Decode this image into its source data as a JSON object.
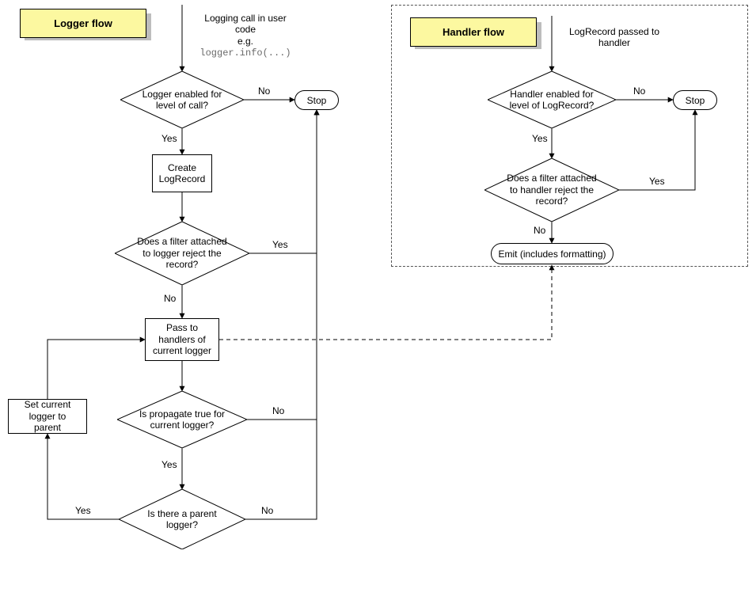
{
  "titles": {
    "logger": "Logger flow",
    "handler": "Handler flow"
  },
  "logger": {
    "entry_l1": "Logging call in user",
    "entry_l2": "code",
    "entry_l3": "e.g.",
    "entry_code": "logger.info(...)",
    "d_enabled_l1": "Logger enabled for",
    "d_enabled_l2": "level of call?",
    "no1": "No",
    "yes1": "Yes",
    "stop": "Stop",
    "create_l1": "Create",
    "create_l2": "LogRecord",
    "d_filter_l1": "Does a filter attached",
    "d_filter_l2": "to logger reject the",
    "d_filter_l3": "record?",
    "yes2": "Yes",
    "no2": "No",
    "pass_l1": "Pass to",
    "pass_l2": "handlers of",
    "pass_l3": "current logger",
    "d_prop_l1": "Is propagate true for",
    "d_prop_l2": "current logger?",
    "no3": "No",
    "yes3": "Yes",
    "d_parent_l1": "Is there a parent",
    "d_parent_l2": "logger?",
    "yes4": "Yes",
    "no4": "No",
    "set_parent_l1": "Set current",
    "set_parent_l2": "logger to parent"
  },
  "handler": {
    "entry_l1": "LogRecord passed to",
    "entry_l2": "handler",
    "d_enabled_l1": "Handler enabled for",
    "d_enabled_l2": "level of LogRecord?",
    "no1": "No",
    "yes1": "Yes",
    "stop": "Stop",
    "d_filter_l1": "Does a filter attached",
    "d_filter_l2": "to handler reject the",
    "d_filter_l3": "record?",
    "yes2": "Yes",
    "no2": "No",
    "emit": "Emit (includes formatting)"
  },
  "chart_data": {
    "type": "flowchart",
    "flows": [
      {
        "name": "Logger flow",
        "start": "Logging call in user code e.g. logger.info(...)",
        "nodes": [
          {
            "id": "L1",
            "type": "decision",
            "text": "Logger enabled for level of call?",
            "yes": "L2",
            "no": "LSTOP"
          },
          {
            "id": "L2",
            "type": "process",
            "text": "Create LogRecord",
            "next": "L3"
          },
          {
            "id": "L3",
            "type": "decision",
            "text": "Does a filter attached to logger reject the record?",
            "yes": "LSTOP",
            "no": "L4"
          },
          {
            "id": "L4",
            "type": "process",
            "text": "Pass to handlers of current logger",
            "next": "L5",
            "link_to_subflow": "Handler flow"
          },
          {
            "id": "L5",
            "type": "decision",
            "text": "Is propagate true for current logger?",
            "yes": "L6",
            "no": "LSTOP"
          },
          {
            "id": "L6",
            "type": "decision",
            "text": "Is there a parent logger?",
            "yes": "L7",
            "no": "LSTOP"
          },
          {
            "id": "L7",
            "type": "process",
            "text": "Set current logger to parent",
            "next": "L4"
          },
          {
            "id": "LSTOP",
            "type": "terminal",
            "text": "Stop"
          }
        ]
      },
      {
        "name": "Handler flow",
        "start": "LogRecord passed to handler",
        "nodes": [
          {
            "id": "H1",
            "type": "decision",
            "text": "Handler enabled for level of LogRecord?",
            "yes": "H2",
            "no": "HSTOP"
          },
          {
            "id": "H2",
            "type": "decision",
            "text": "Does a filter attached to handler reject the record?",
            "yes": "HSTOP",
            "no": "H3"
          },
          {
            "id": "H3",
            "type": "terminal",
            "text": "Emit (includes formatting)"
          },
          {
            "id": "HSTOP",
            "type": "terminal",
            "text": "Stop"
          }
        ]
      }
    ]
  }
}
